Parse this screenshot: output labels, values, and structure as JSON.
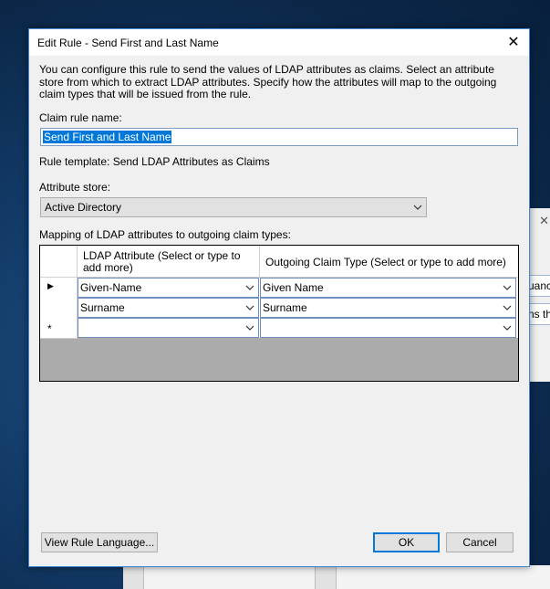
{
  "background": {
    "partial_texts": [
      "uanc",
      "ns tha"
    ]
  },
  "dialog": {
    "title": "Edit Rule - Send First and Last Name",
    "close_glyph": "✕",
    "description": "You can configure this rule to send the values of LDAP attributes as claims. Select an attribute store from which to extract LDAP attributes. Specify how the attributes will map to the outgoing claim types that will be issued from the rule.",
    "claim_rule_name_label": "Claim rule name:",
    "claim_rule_name_value": "Send First and Last Name",
    "rule_template_text": "Rule template: Send LDAP Attributes as Claims",
    "attribute_store_label": "Attribute store:",
    "attribute_store_value": "Active Directory",
    "mapping_label": "Mapping of LDAP attributes to outgoing claim types:",
    "grid": {
      "headers": [
        "LDAP Attribute (Select or type to add more)",
        "Outgoing Claim Type (Select or type to add more)"
      ],
      "rows": [
        {
          "marker": "▶",
          "ldap": "Given-Name",
          "claim": "Given Name"
        },
        {
          "marker": "",
          "ldap": "Surname",
          "claim": "Surname"
        },
        {
          "marker": "*",
          "ldap": "",
          "claim": ""
        }
      ]
    },
    "buttons": {
      "view_rule_language": "View Rule Language...",
      "ok": "OK",
      "cancel": "Cancel"
    }
  }
}
